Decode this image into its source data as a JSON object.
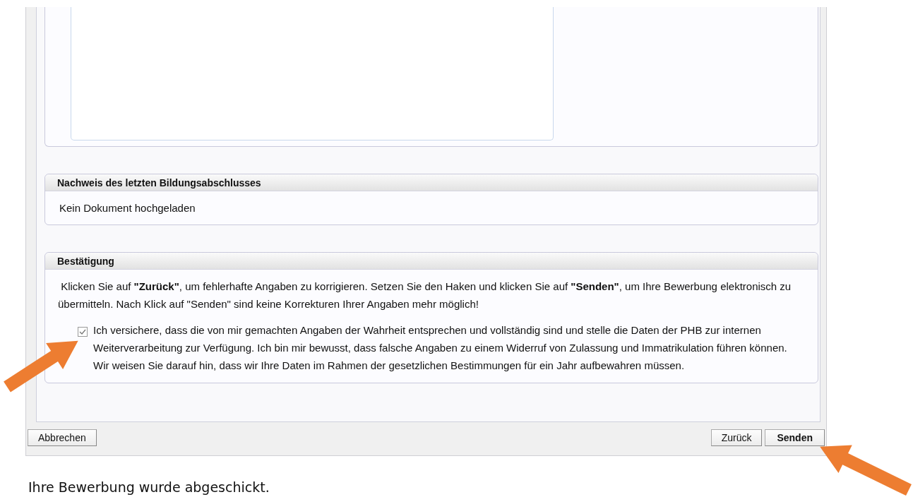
{
  "sections": [
    {
      "kind": "textarea"
    },
    {
      "kind": "text",
      "title": "Nachweis des letzten Bildungsabschlusses",
      "text": "Kein Dokument hochgeladen"
    },
    {
      "kind": "confirmation",
      "title": "Bestätigung",
      "paragraph": " Klicken Sie auf **\"Zurück\"**, um fehlerhafte Angaben zu korrigieren. Setzen Sie den Haken und klicken Sie auf **\"Senden\"**, um Ihre Bewerbung elektronisch zu übermitteln. Nach Klick auf \"Senden\" sind keine Korrekturen Ihrer Angaben mehr möglich!",
      "checkbox": {
        "checked": true,
        "label": "Ich versichere, dass die von mir gemachten Angaben der Wahrheit entsprechen und vollständig sind und stelle die Daten der PHB zur internen Weiterverarbeitung zur Verfügung. Ich bin mir bewusst, dass falsche Angaben zu einem Widerruf von Zulassung und Immatrikulation führen können. Wir weisen Sie darauf hin, dass wir Ihre Daten im Rahmen der gesetzlichen Bestimmungen für ein Jahr aufbewahren müssen."
      }
    }
  ],
  "buttons_left": [
    {
      "label": "Abbrechen",
      "bold": false
    }
  ],
  "buttons_right": [
    {
      "label": "Zurück",
      "bold": false
    },
    {
      "label": "Senden",
      "bold": true
    }
  ],
  "caption": "Ihre Bewerbung wurde abgeschickt."
}
